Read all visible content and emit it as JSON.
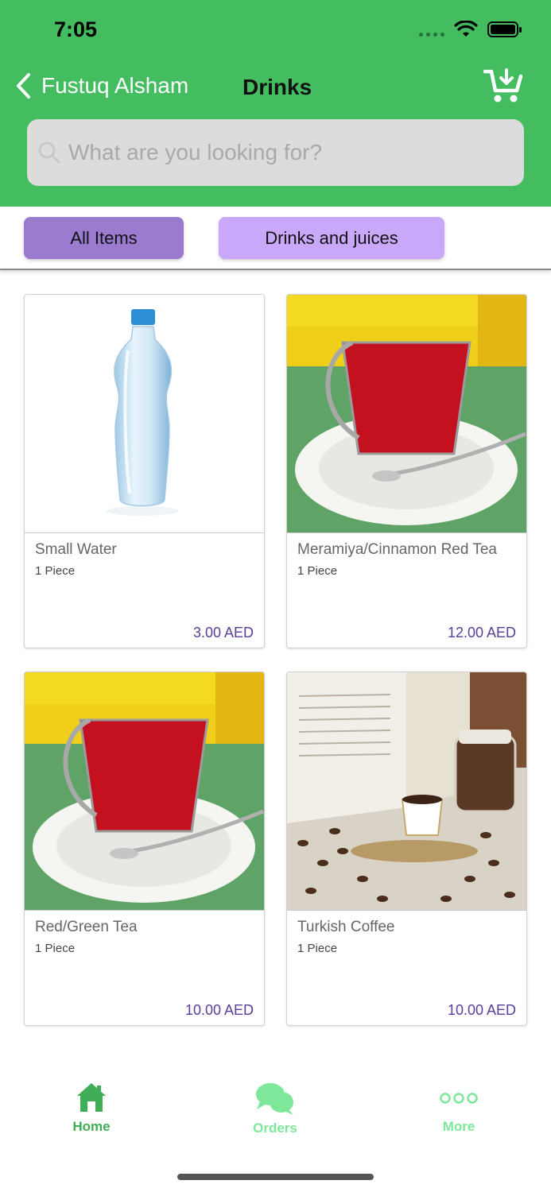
{
  "status": {
    "time": "7:05"
  },
  "nav": {
    "back_label": "Fustuq Alsham",
    "title": "Drinks"
  },
  "search": {
    "placeholder": "What are you looking for?"
  },
  "categories": [
    {
      "label": "All Items",
      "selected": true
    },
    {
      "label": "Drinks and juices",
      "selected": false
    }
  ],
  "products": [
    {
      "name": "Small Water",
      "unit": "1 Piece",
      "price": "3.00 AED",
      "image": "water-bottle"
    },
    {
      "name": "Meramiya/Cinnamon Red Tea",
      "unit": "1 Piece",
      "price": "12.00 AED",
      "image": "red-tea-cup"
    },
    {
      "name": "Red/Green Tea",
      "unit": "1 Piece",
      "price": "10.00 AED",
      "image": "red-tea-cup"
    },
    {
      "name": "Turkish Coffee",
      "unit": "1 Piece",
      "price": "10.00 AED",
      "image": "turkish-coffee"
    }
  ],
  "tabbar": {
    "items": [
      {
        "label": "Home",
        "icon": "home-icon",
        "active": true
      },
      {
        "label": "Orders",
        "icon": "chat-bubbles-icon",
        "active": false
      },
      {
        "label": "More",
        "icon": "more-dots-icon",
        "active": false
      }
    ]
  },
  "colors": {
    "header_bg": "#43bd5f",
    "chip_active": "#9a7bd0",
    "chip_inactive": "#c9a8fa",
    "price": "#5a3e9a",
    "tab_active": "#3fae57",
    "tab_inactive": "#7de89a"
  }
}
